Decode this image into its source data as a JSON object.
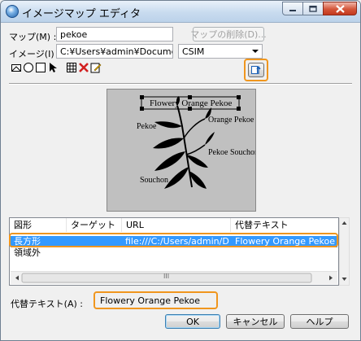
{
  "window": {
    "title": "イメージマップ エディタ"
  },
  "fields": {
    "map_label": "マップ(M) :",
    "map_value": "pekoe",
    "delete_map_button": "マップの削除(D)...",
    "image_label": "イメージ(I) :",
    "image_path": "C:¥Users¥admin¥Documents¥hpb",
    "image_type": "CSIM"
  },
  "preview": {
    "labels": [
      "Flowery Orange Pekoe",
      "Pekoe",
      "Orange Pekoe",
      "Pekoe Souchon",
      "Souchon"
    ]
  },
  "table": {
    "headers": [
      "図形",
      "ターゲット",
      "URL",
      "代替テキスト"
    ],
    "rows": [
      [
        "長方形",
        "",
        "file:///C:/Users/admin/Doc...",
        "Flowery Orange Pekoe"
      ],
      [
        "領域外",
        "",
        "",
        ""
      ]
    ],
    "scroll_marker": "III"
  },
  "alt_text": {
    "label": "代替テキスト(A) :",
    "value": "Flowery Orange Pekoe"
  },
  "buttons": {
    "ok": "OK",
    "cancel": "キャンセル",
    "help": "ヘルプ"
  },
  "colors": {
    "highlight": "#f0961e",
    "selection": "#3399ff"
  }
}
